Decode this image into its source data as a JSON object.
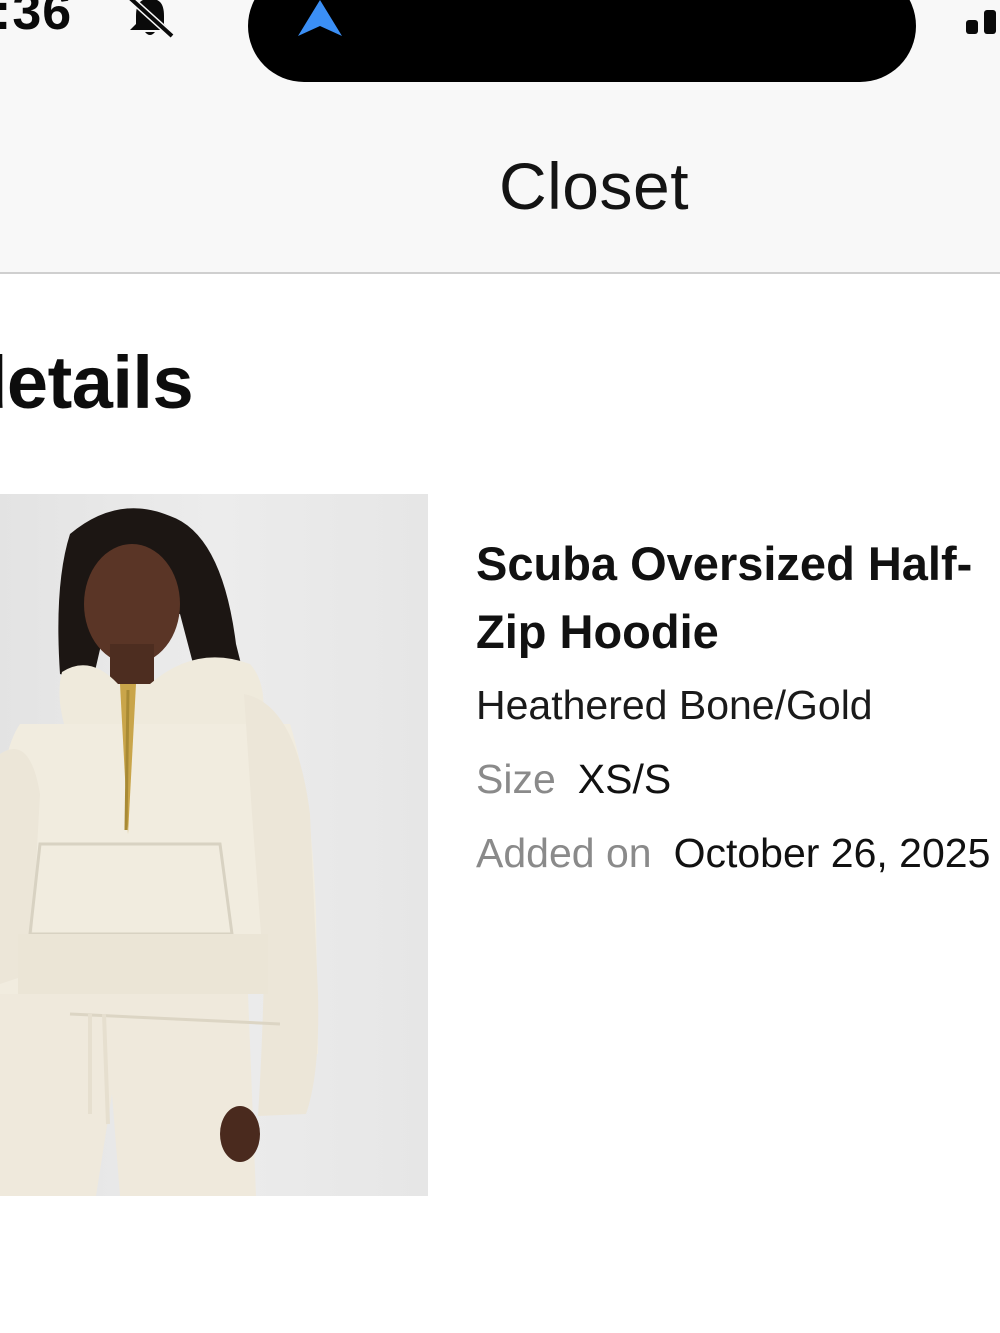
{
  "status_bar": {
    "time": ":36",
    "icons": [
      "bell-slash-icon",
      "location-arrow-icon",
      "cellular-signal-icon"
    ],
    "location_color": "#3b8ff5"
  },
  "header": {
    "title": "Closet"
  },
  "section": {
    "heading": "Item details"
  },
  "item": {
    "image": "model-wearing-hoodie-photo",
    "name": "Scuba Oversized Half-Zip Hoodie",
    "color": "Heathered Bone/Gold",
    "size_label": "Size",
    "size_value": "XS/S",
    "added_label": "Added on",
    "added_value": "October 26, 2025"
  }
}
